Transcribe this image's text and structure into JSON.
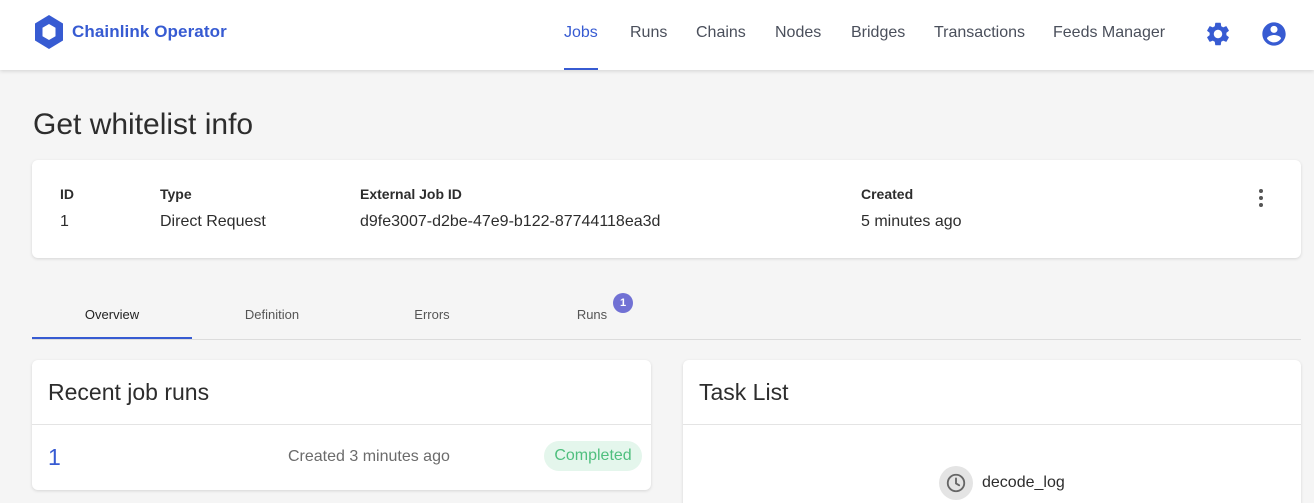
{
  "brand": {
    "name": "Chainlink Operator"
  },
  "nav": {
    "items": [
      "Jobs",
      "Runs",
      "Chains",
      "Nodes",
      "Bridges",
      "Transactions",
      "Feeds Manager"
    ],
    "active": "Jobs"
  },
  "header_icons": [
    "gear-icon",
    "account-circle-icon"
  ],
  "page": {
    "title": "Get whitelist info"
  },
  "job": {
    "labels": {
      "id": "ID",
      "type": "Type",
      "external_id": "External Job ID",
      "created": "Created"
    },
    "values": {
      "id": "1",
      "type": "Direct Request",
      "external_id": "d9fe3007-d2be-47e9-b122-87744118ea3d",
      "created": "5 minutes ago"
    }
  },
  "tabs": {
    "items": [
      "Overview",
      "Definition",
      "Errors",
      "Runs"
    ],
    "active": "Overview",
    "runs_badge": "1"
  },
  "recent_runs": {
    "title": "Recent job runs",
    "rows": [
      {
        "id": "1",
        "created": "Created 3 minutes ago",
        "status": "Completed"
      }
    ]
  },
  "task_list": {
    "title": "Task List",
    "tasks": [
      {
        "name": "decode_log",
        "icon": "clock-icon"
      }
    ]
  },
  "colors": {
    "accent": "#375bd2",
    "badge": "#7171d4",
    "status_completed": "#4fbf7e"
  }
}
